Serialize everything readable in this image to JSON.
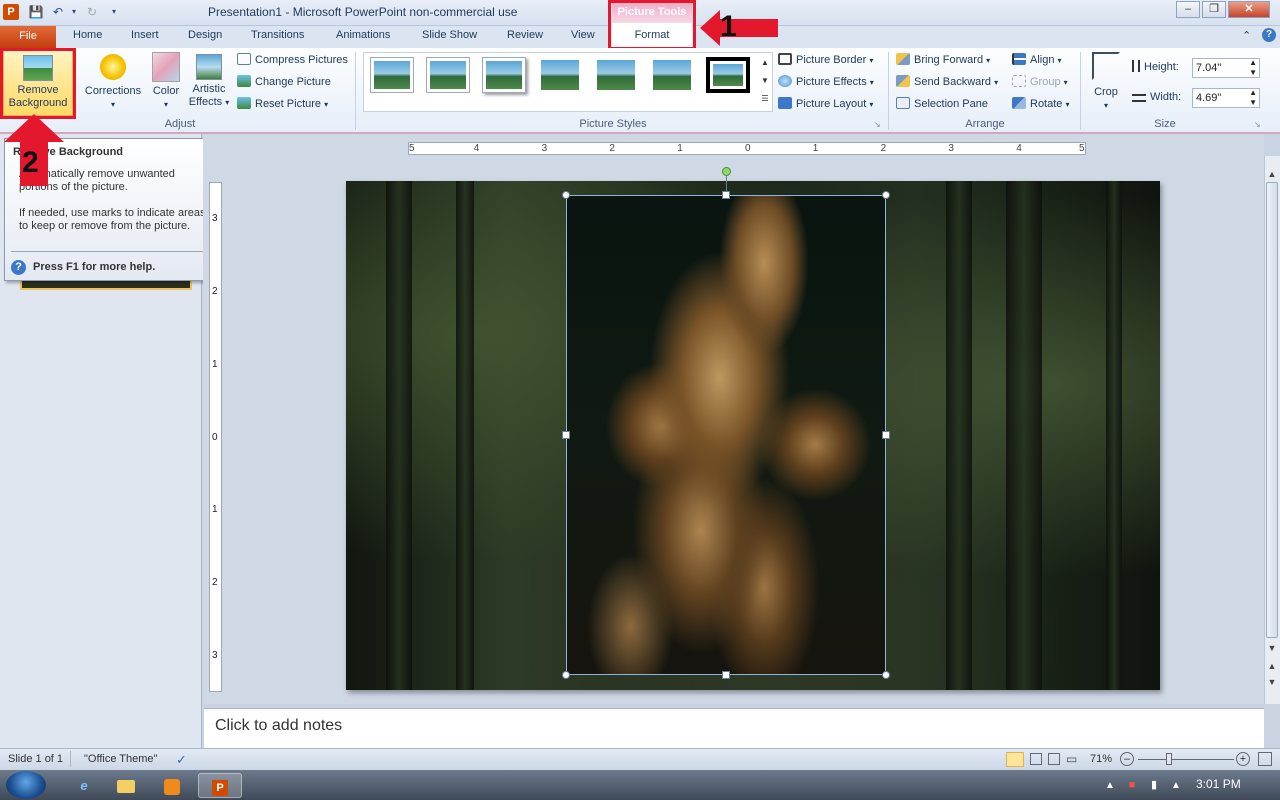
{
  "window": {
    "title": "Presentation1  -  Microsoft PowerPoint non-commercial use"
  },
  "context_tab": {
    "group": "Picture Tools",
    "tab": "Format"
  },
  "tabs": [
    "File",
    "Home",
    "Insert",
    "Design",
    "Transitions",
    "Animations",
    "Slide Show",
    "Review",
    "View"
  ],
  "ribbon": {
    "adjust": {
      "remove_bg": [
        "Remove",
        "Background"
      ],
      "corrections": "Corrections",
      "color": "Color",
      "artistic": [
        "Artistic",
        "Effects"
      ],
      "compress": "Compress Pictures",
      "change": "Change Picture",
      "reset": "Reset Picture",
      "label": "Adjust"
    },
    "styles": {
      "border": "Picture Border",
      "effects": "Picture Effects",
      "layout": "Picture Layout",
      "label": "Picture Styles"
    },
    "arrange": {
      "bring_forward": "Bring Forward",
      "send_backward": "Send Backward",
      "selection_pane": "Selection Pane",
      "align": "Align",
      "group": "Group",
      "rotate": "Rotate",
      "label": "Arrange"
    },
    "size": {
      "crop": "Crop",
      "height_label": "Height:",
      "height_value": "7.04\"",
      "width_label": "Width:",
      "width_value": "4.69\"",
      "label": "Size"
    }
  },
  "tooltip": {
    "title": "Remove Background",
    "line1": "Automatically remove unwanted portions of the picture.",
    "line2": "If needed, use marks to indicate areas to keep or remove from the picture.",
    "help": "Press F1 for more help."
  },
  "annotations": {
    "one": "1",
    "two": "2"
  },
  "ruler_numbers": [
    "5",
    "4",
    "3",
    "2",
    "1",
    "0",
    "1",
    "2",
    "3",
    "4",
    "5"
  ],
  "vruler_numbers": [
    "3",
    "2",
    "1",
    "0",
    "1",
    "2",
    "3"
  ],
  "notes_placeholder": "Click to add notes",
  "status": {
    "slide": "Slide 1 of 1",
    "theme": "\"Office Theme\"",
    "zoom": "71%"
  },
  "taskbar": {
    "time": "3:01 PM"
  },
  "colors": {
    "accent_red": "#e3182d",
    "file_tab": "#c23d0d",
    "context_pink": "#f0a9c6"
  }
}
